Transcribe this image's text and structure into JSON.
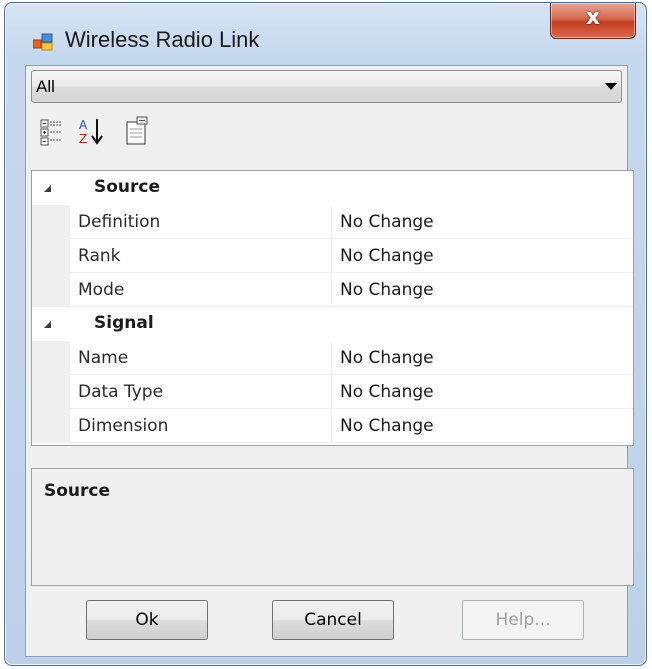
{
  "window": {
    "title": "Wireless Radio Link",
    "close_glyph": "x"
  },
  "filter": {
    "selected": "All"
  },
  "toolbar": {
    "buttons": [
      "categorized-icon",
      "alphabetical-sort-icon",
      "property-pages-icon"
    ]
  },
  "grid": {
    "categories": [
      {
        "label": "Source",
        "properties": [
          {
            "name": "Definition",
            "value": "No Change"
          },
          {
            "name": "Rank",
            "value": "No Change"
          },
          {
            "name": "Mode",
            "value": "No Change"
          }
        ]
      },
      {
        "label": "Signal",
        "properties": [
          {
            "name": "Name",
            "value": "No Change"
          },
          {
            "name": "Data Type",
            "value": "No Change"
          },
          {
            "name": "Dimension",
            "value": "No Change"
          }
        ]
      }
    ]
  },
  "description": {
    "title": "Source"
  },
  "buttons": {
    "ok": "Ok",
    "cancel": "Cancel",
    "help": "Help..."
  },
  "colors": {
    "titlebar": "#c6d8ee",
    "close_button": "#c33d1f",
    "client_background": "#f0f0f0"
  }
}
